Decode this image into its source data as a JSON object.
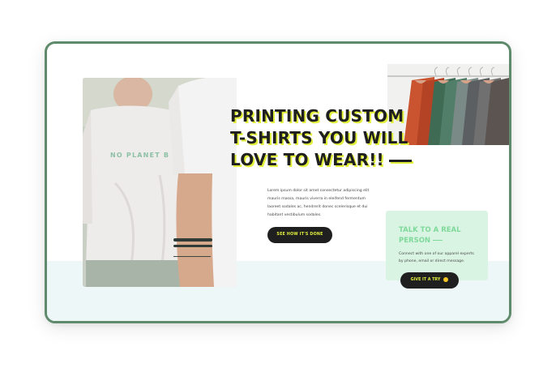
{
  "hero": {
    "title_lines": [
      "PRINTING CUSTOM",
      "T-SHIRTS YOU WILL",
      "LOVE TO WEAR!!"
    ],
    "description": "Lorem ipsum dolor sit amet consectetur adipiscing elit mauris massa, mauris viverra in eleifend fermentum laoreet sodales ac, hendrerit donec scelerisque et dui habitant vestibulum sodales.",
    "cta_label": "SEE HOW IT'S DONE",
    "shirt_print": "NO PLANET B"
  },
  "card": {
    "title": "TALK TO A REAL PERSON",
    "text": "Connect with one of our apparel experts by phone, email or direct message.",
    "button_label": "GIVE IT A TRY"
  },
  "colors": {
    "frame_border": "#5f8a6c",
    "accent_yellow": "#e2ef3b",
    "card_bg": "#d9f4e3",
    "card_title": "#7fd99a",
    "button_bg": "#1f1f1f"
  }
}
